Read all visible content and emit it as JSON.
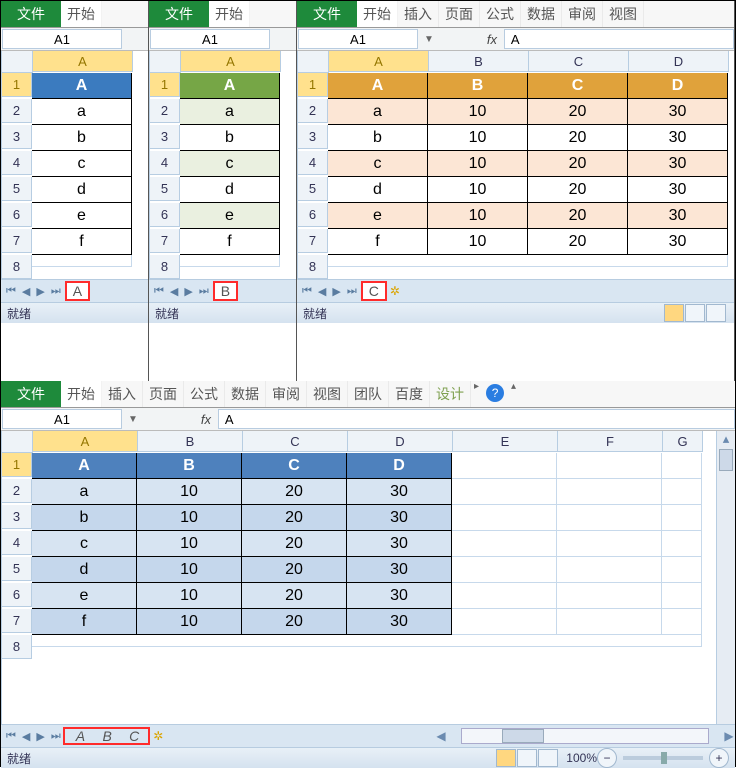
{
  "app_a": {
    "ribbon": {
      "file": "文件",
      "tabs": [
        "开始"
      ]
    },
    "name_box": "A1",
    "col_headers": [
      "A"
    ],
    "rows": [
      1,
      2,
      3,
      4,
      5,
      6,
      7
    ],
    "data_header": [
      "A"
    ],
    "data_rows": [
      [
        "a"
      ],
      [
        "b"
      ],
      [
        "c"
      ],
      [
        "d"
      ],
      [
        "e"
      ],
      [
        "f"
      ]
    ],
    "sheet_tab": "A",
    "status": "就绪"
  },
  "app_b": {
    "ribbon": {
      "file": "文件",
      "tabs": [
        "开始"
      ]
    },
    "name_box": "A1",
    "col_headers": [
      "A"
    ],
    "rows": [
      1,
      2,
      3,
      4,
      5,
      6,
      7
    ],
    "data_header": [
      "A"
    ],
    "data_rows": [
      [
        "a"
      ],
      [
        "b"
      ],
      [
        "c"
      ],
      [
        "d"
      ],
      [
        "e"
      ],
      [
        "f"
      ]
    ],
    "sheet_tab": "B",
    "status": "就绪"
  },
  "app_c": {
    "ribbon": {
      "file": "文件",
      "tabs": [
        "开始",
        "插入",
        "页面",
        "公式",
        "数据",
        "审阅",
        "视图"
      ]
    },
    "name_box": "A1",
    "formula_value": "A",
    "col_headers": [
      "A",
      "B",
      "C",
      "D"
    ],
    "rows": [
      1,
      2,
      3,
      4,
      5,
      6,
      7
    ],
    "data_header": [
      "A",
      "B",
      "C",
      "D"
    ],
    "data_rows": [
      [
        "a",
        "10",
        "20",
        "30"
      ],
      [
        "b",
        "10",
        "20",
        "30"
      ],
      [
        "c",
        "10",
        "20",
        "30"
      ],
      [
        "d",
        "10",
        "20",
        "30"
      ],
      [
        "e",
        "10",
        "20",
        "30"
      ],
      [
        "f",
        "10",
        "20",
        "30"
      ]
    ],
    "sheet_tab": "C",
    "status": "就绪"
  },
  "app_main": {
    "ribbon": {
      "file": "文件",
      "tabs": [
        "开始",
        "插入",
        "页面",
        "公式",
        "数据",
        "审阅",
        "视图",
        "团队",
        "百度",
        "设计"
      ]
    },
    "name_box": "A1",
    "formula_value": "A",
    "col_headers": [
      "A",
      "B",
      "C",
      "D",
      "E",
      "F"
    ],
    "rows": [
      1,
      2,
      3,
      4,
      5,
      6,
      7
    ],
    "data_header": [
      "A",
      "B",
      "C",
      "D"
    ],
    "data_rows": [
      [
        "a",
        "10",
        "20",
        "30"
      ],
      [
        "b",
        "10",
        "20",
        "30"
      ],
      [
        "c",
        "10",
        "20",
        "30"
      ],
      [
        "d",
        "10",
        "20",
        "30"
      ],
      [
        "e",
        "10",
        "20",
        "30"
      ],
      [
        "f",
        "10",
        "20",
        "30"
      ]
    ],
    "sheet_tabs": [
      "A",
      "B",
      "C"
    ],
    "status": "就绪",
    "zoom": "100%"
  },
  "chart_data": {
    "type": "table",
    "title": "Merged worksheet data",
    "columns": [
      "A",
      "B",
      "C",
      "D"
    ],
    "rows": [
      [
        "a",
        10,
        20,
        30
      ],
      [
        "b",
        10,
        20,
        30
      ],
      [
        "c",
        10,
        20,
        30
      ],
      [
        "d",
        10,
        20,
        30
      ],
      [
        "e",
        10,
        20,
        30
      ],
      [
        "f",
        10,
        20,
        30
      ]
    ]
  }
}
